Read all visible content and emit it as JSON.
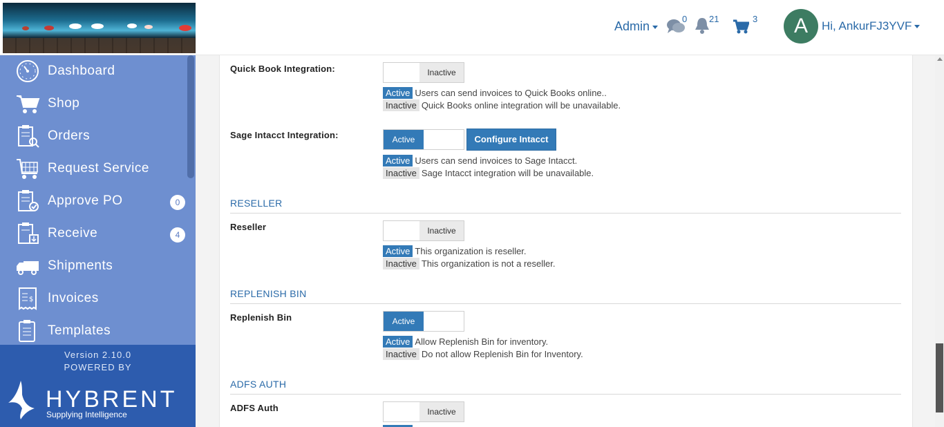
{
  "header": {
    "admin_label": "Admin",
    "messages_count": "0",
    "notifications_count": "21",
    "cart_count": "3",
    "avatar_letter": "A",
    "greeting": "Hi, AnkurFJ3YVF"
  },
  "sidebar": {
    "items": [
      {
        "label": "Dashboard",
        "icon": "dashboard-icon"
      },
      {
        "label": "Shop",
        "icon": "cart-icon"
      },
      {
        "label": "Orders",
        "icon": "orders-icon"
      },
      {
        "label": "Request Service",
        "icon": "service-icon"
      },
      {
        "label": "Approve PO",
        "icon": "approve-icon",
        "badge": "0"
      },
      {
        "label": "Receive",
        "icon": "receive-icon",
        "badge": "4"
      },
      {
        "label": "Shipments",
        "icon": "truck-icon"
      },
      {
        "label": "Invoices",
        "icon": "invoice-icon"
      },
      {
        "label": "Templates",
        "icon": "template-icon"
      }
    ],
    "version": "Version 2.10.0",
    "powered_by": "POWERED BY",
    "brand": "HYBRENT",
    "tagline": "Supplying Intelligence"
  },
  "settings": {
    "quickbooks": {
      "label": "Quick Book Integration:",
      "toggle": "Inactive",
      "active_tag": "Active",
      "active_desc": "Users can send invoices to Quick Books online..",
      "inactive_tag": "Inactive",
      "inactive_desc": "Quick Books online integration will be unavailable."
    },
    "sage": {
      "label": "Sage Intacct Integration:",
      "toggle": "Active",
      "configure_button": "Configure Intacct",
      "active_tag": "Active",
      "active_desc": "Users can send invoices to Sage Intacct.",
      "inactive_tag": "Inactive",
      "inactive_desc": "Sage Intacct integration will be unavailable."
    },
    "reseller_section": "RESELLER",
    "reseller": {
      "label": "Reseller",
      "toggle": "Inactive",
      "active_tag": "Active",
      "active_desc": "This organization is reseller.",
      "inactive_tag": "Inactive",
      "inactive_desc": "This organization is not a reseller."
    },
    "replenish_section": "REPLENISH BIN",
    "replenish": {
      "label": "Replenish Bin",
      "toggle": "Active",
      "active_tag": "Active",
      "active_desc": "Allow Replenish Bin for inventory.",
      "inactive_tag": "Inactive",
      "inactive_desc": "Do not allow Replenish Bin for Inventory."
    },
    "adfs_section": "ADFS AUTH",
    "adfs": {
      "label": "ADFS Auth",
      "toggle": "Inactive"
    }
  },
  "colors": {
    "accent": "#337ab7",
    "sidebar": "#6e8fd0",
    "sidebar_footer": "#2d5cae"
  }
}
